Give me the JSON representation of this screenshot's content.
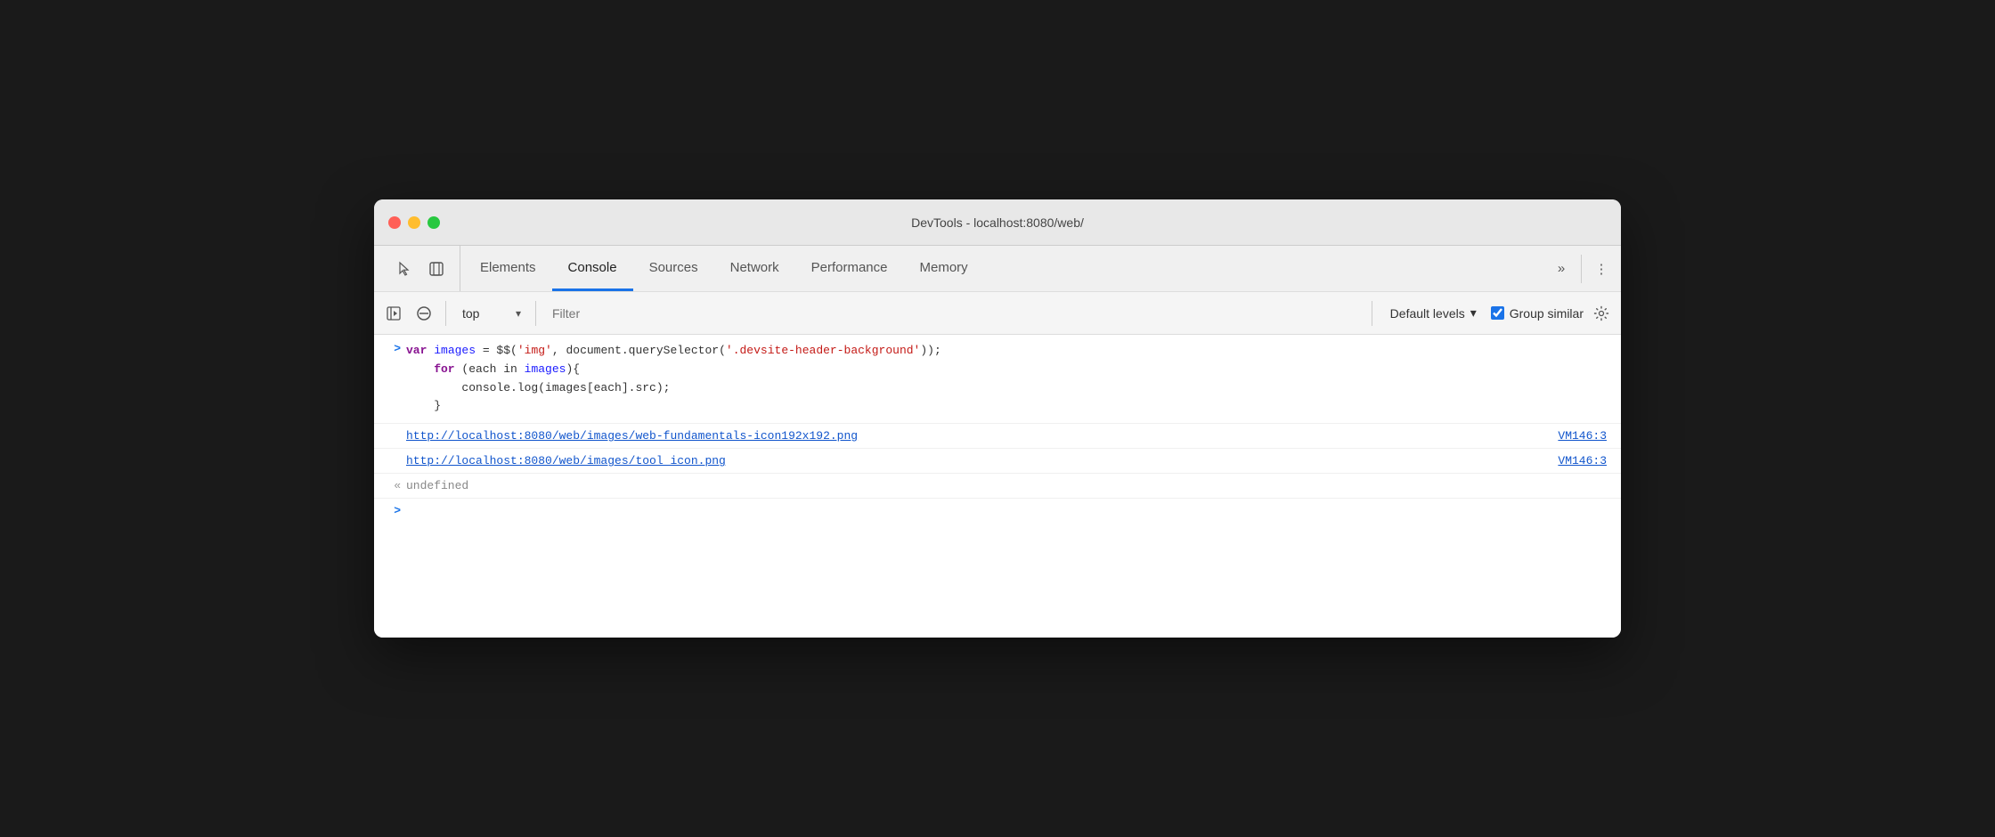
{
  "titlebar": {
    "title": "DevTools - localhost:8080/web/"
  },
  "tabs": {
    "items": [
      {
        "id": "elements",
        "label": "Elements",
        "active": false
      },
      {
        "id": "console",
        "label": "Console",
        "active": true
      },
      {
        "id": "sources",
        "label": "Sources",
        "active": false
      },
      {
        "id": "network",
        "label": "Network",
        "active": false
      },
      {
        "id": "performance",
        "label": "Performance",
        "active": false
      },
      {
        "id": "memory",
        "label": "Memory",
        "active": false
      }
    ],
    "more_label": "»",
    "menu_label": "⋮"
  },
  "toolbar": {
    "context_options": [
      "top"
    ],
    "context_value": "top",
    "context_arrow": "▾",
    "filter_placeholder": "Filter",
    "levels_label": "Default levels",
    "levels_arrow": "▾",
    "group_similar_label": "Group similar",
    "group_similar_checked": true
  },
  "console": {
    "prompt_arrow": ">",
    "return_arrow": "«",
    "code_block": {
      "line1": "var images = $$('img', document.querySelector('.devsite-header-background'));",
      "line2": "    for (each in images){",
      "line3": "        console.log(images[each].src);",
      "line4": "    }"
    },
    "log_entries": [
      {
        "url": "http://localhost:8080/web/images/web-fundamentals-icon192x192.png",
        "ref": "VM146:3"
      },
      {
        "url": "http://localhost:8080/web/images/tool_icon.png",
        "ref": "VM146:3"
      }
    ],
    "undefined_text": "undefined",
    "input_placeholder": ""
  }
}
